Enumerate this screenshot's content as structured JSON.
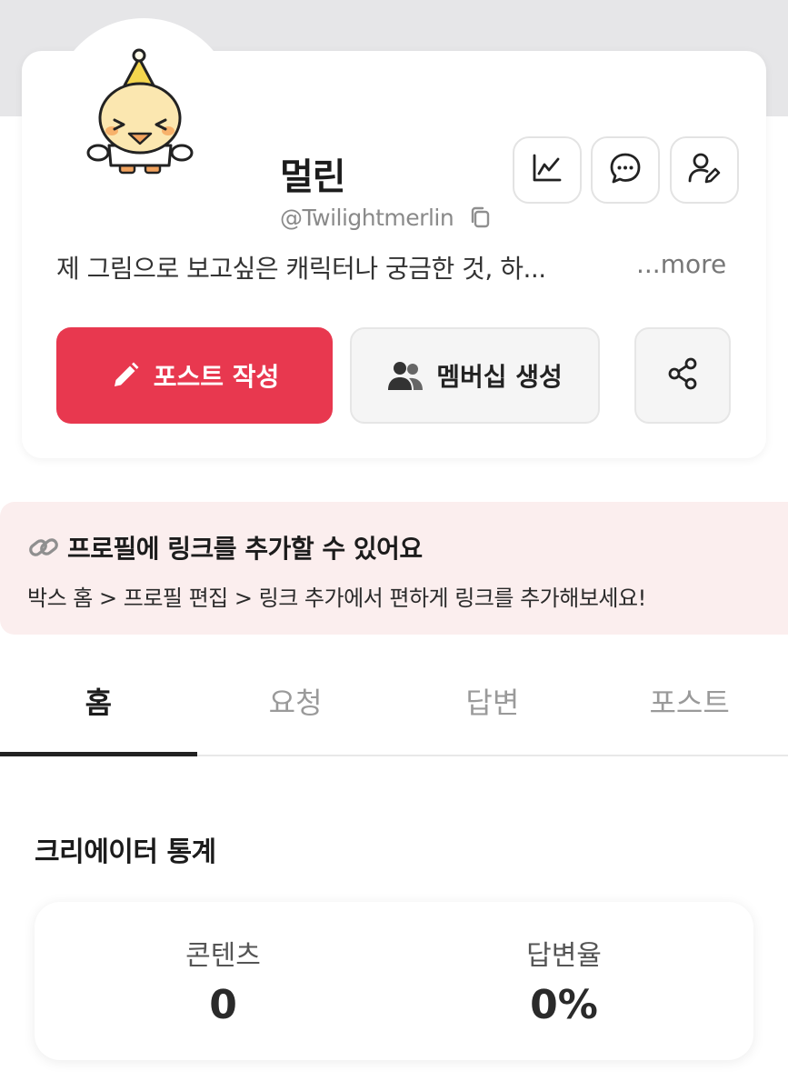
{
  "profile": {
    "name": "멀린",
    "handle": "@Twilightmerlin",
    "bio": "제 그림으로 보고싶은 캐릭터나 궁금한 것, 하...",
    "more_label": "...more"
  },
  "actions": {
    "post_label": "포스트 작성",
    "membership_label": "멤버십 생성"
  },
  "icons": {
    "stats": "chart-line-icon",
    "message": "chat-bubble-icon",
    "edit_profile": "user-edit-icon",
    "copy": "copy-icon",
    "pencil": "pencil-icon",
    "members": "users-icon",
    "share": "share-icon",
    "link": "link-icon"
  },
  "banner": {
    "title": "프로필에 링크를 추가할 수 있어요",
    "subtitle": "박스 홈 > 프로필 편집 > 링크 추가에서 편하게 링크를 추가해보세요!"
  },
  "tabs": [
    {
      "label": "홈",
      "active": true
    },
    {
      "label": "요청",
      "active": false
    },
    {
      "label": "답변",
      "active": false
    },
    {
      "label": "포스트",
      "active": false
    }
  ],
  "stats_section": {
    "title": "크리에이터 통계",
    "items": [
      {
        "label": "콘텐츠",
        "value": "0"
      },
      {
        "label": "답변율",
        "value": "0%"
      }
    ]
  },
  "colors": {
    "primary": "#e8384f",
    "banner_bg": "#fbeeee",
    "top_band": "#e6e6e8"
  }
}
